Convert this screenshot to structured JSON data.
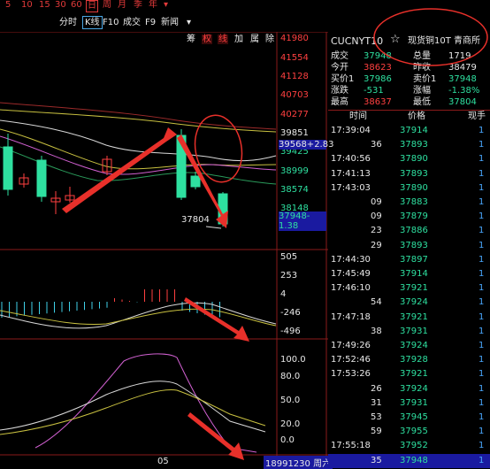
{
  "period_bar": {
    "items": [
      "5",
      "10",
      "15",
      "30",
      "60",
      "日",
      "周",
      "月",
      "季",
      "年"
    ],
    "selected": "日",
    "more": "▾"
  },
  "toolbar": {
    "items": [
      "分时",
      "K线",
      "F10",
      "成交",
      "F9",
      "新闻"
    ],
    "selected": "K线",
    "more": "▾"
  },
  "mark_buttons": [
    "筹",
    "权",
    "线",
    "加",
    "属",
    "除"
  ],
  "main_axis": [
    "41980",
    "41554",
    "41128",
    "40703",
    "40277",
    "39851",
    "39425",
    "38999",
    "38574",
    "38148",
    "37722"
  ],
  "price_tags": {
    "ma_tag": "39568+2.83",
    "last_tag": "37948-1.38",
    "low_label": "37804"
  },
  "macd_axis": [
    "505",
    "253",
    "4",
    "-246",
    "-496"
  ],
  "kdj_axis": [
    "100.0",
    "80.0",
    "50.0",
    "20.0",
    "0.0"
  ],
  "bottom": {
    "x_label": "05",
    "volume": "18991230",
    "weekday": "周六"
  },
  "quote": {
    "code": "CUCNYT10",
    "name": "现货铜10T 青商所",
    "star": "☆",
    "rows": [
      {
        "l1": "成交",
        "v1": "37948",
        "c1": "c-green",
        "l2": "总量",
        "v2": "1719",
        "c2": "c-white"
      },
      {
        "l1": "今开",
        "v1": "38623",
        "c1": "c-red",
        "l2": "昨收",
        "v2": "38479",
        "c2": "c-white"
      },
      {
        "l1": "买价1",
        "v1": "37986",
        "c1": "c-green",
        "l2": "卖价1",
        "v2": "37948",
        "c2": "c-green"
      },
      {
        "l1": "涨跌",
        "v1": "-531",
        "c1": "c-green",
        "l2": "涨幅",
        "v2": "-1.38%",
        "c2": "c-green"
      },
      {
        "l1": "最高",
        "v1": "38637",
        "c1": "c-red",
        "l2": "最低",
        "v2": "37804",
        "c2": "c-green"
      }
    ],
    "tick_headers": [
      "时间",
      "价格",
      "现手"
    ],
    "ticks": [
      {
        "time": "17:39:04",
        "price": "37914",
        "vol": "1"
      },
      {
        "time": "36",
        "price": "37893",
        "vol": "1"
      },
      {
        "time": "17:40:56",
        "price": "37890",
        "vol": "1"
      },
      {
        "time": "17:41:13",
        "price": "37893",
        "vol": "1"
      },
      {
        "time": "17:43:03",
        "price": "37890",
        "vol": "1"
      },
      {
        "time": "09",
        "price": "37883",
        "vol": "1"
      },
      {
        "time": "09",
        "price": "37879",
        "vol": "1"
      },
      {
        "time": "23",
        "price": "37886",
        "vol": "1"
      },
      {
        "time": "29",
        "price": "37893",
        "vol": "1"
      },
      {
        "time": "17:44:30",
        "price": "37897",
        "vol": "1"
      },
      {
        "time": "17:45:49",
        "price": "37914",
        "vol": "1"
      },
      {
        "time": "17:46:10",
        "price": "37921",
        "vol": "1"
      },
      {
        "time": "54",
        "price": "37924",
        "vol": "1"
      },
      {
        "time": "17:47:18",
        "price": "37921",
        "vol": "1"
      },
      {
        "time": "38",
        "price": "37931",
        "vol": "1"
      },
      {
        "time": "17:49:26",
        "price": "37924",
        "vol": "1"
      },
      {
        "time": "17:52:46",
        "price": "37928",
        "vol": "1"
      },
      {
        "time": "17:53:26",
        "price": "37921",
        "vol": "1"
      },
      {
        "time": "26",
        "price": "37924",
        "vol": "1"
      },
      {
        "time": "31",
        "price": "37931",
        "vol": "1"
      },
      {
        "time": "53",
        "price": "37945",
        "vol": "1"
      },
      {
        "time": "59",
        "price": "37955",
        "vol": "1"
      },
      {
        "time": "17:55:18",
        "price": "37952",
        "vol": "1"
      },
      {
        "time": "35",
        "price": "37948",
        "vol": "1"
      }
    ]
  },
  "colors": {
    "up": "#ff4040",
    "down": "#2ee0a0",
    "annotation": "#e8302a",
    "grid": "#8a1a1a",
    "highlight_row": "#1a1aa0"
  }
}
